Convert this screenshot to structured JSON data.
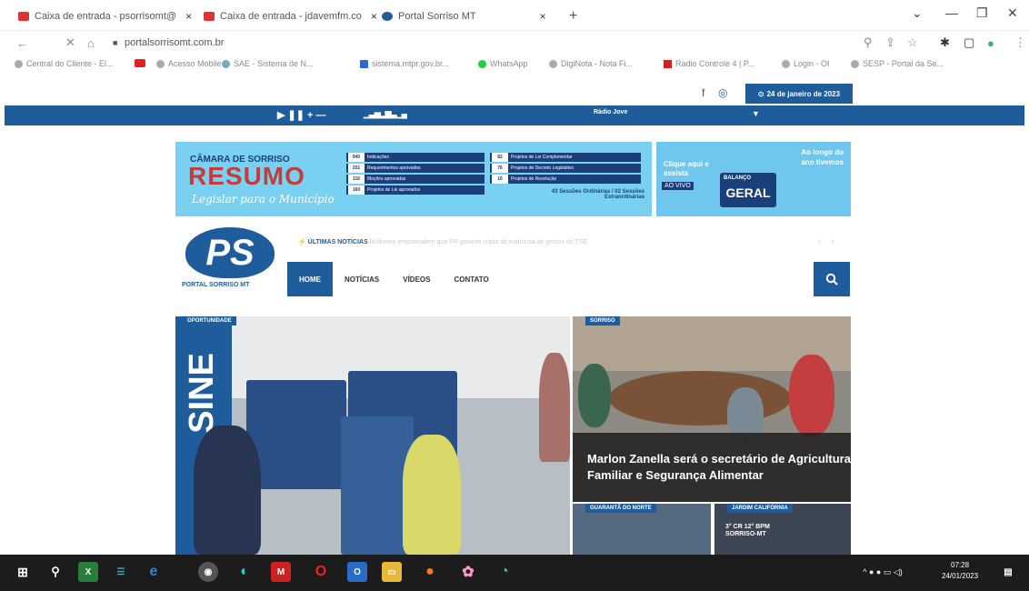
{
  "browser": {
    "tabs": [
      {
        "label": "Caixa de entrada - psorrisomt@",
        "close": "×"
      },
      {
        "label": "Caixa de entrada - jdavemfm.co",
        "close": "×"
      },
      {
        "label": "Portal Sorriso MT",
        "close": "×"
      }
    ],
    "new_tab": "+",
    "url": "portalsorrisomt.com.br",
    "bookmarks": [
      "Central do Cliente - El...",
      "Acesso Mobile",
      "SAE - Sistema de N...",
      "sistema.mtpr.gov.br...",
      "WhatsApp",
      "DigiNota - Nota Fi...",
      "Radio Controle 4 | P...",
      "Login - OI",
      "SESP - Portal da Se..."
    ]
  },
  "site": {
    "date": "24 de janeiro de 2023",
    "radio_player": {
      "controls": "▶ ❚❚ + —",
      "station": "Rádio Jove"
    },
    "banner_camara": {
      "line1": "CÂMARA DE SORRISO",
      "title": "RESUMO",
      "slogan": "Legislar para o Município",
      "stats_left": [
        {
          "n": "940",
          "label": "Indicações"
        },
        {
          "n": "201",
          "label": "Requerimentos aprovados"
        },
        {
          "n": "116",
          "label": "Moções aprovadas"
        },
        {
          "n": "160",
          "label": "Projetos de Lei aprovados"
        }
      ],
      "stats_right": [
        {
          "n": "82",
          "label": "Projetos de Lei Complementar"
        },
        {
          "n": "76",
          "label": "Projetos de Decreto Legislativo"
        },
        {
          "n": "16",
          "label": "Projetos de Resolução"
        }
      ],
      "sessions": "43 Sessões Ordinárias / 02 Sessões Extraordinárias"
    },
    "banner_live": {
      "cta": "Clique aqui e assista",
      "live": "AO VIVO",
      "badge_top": "BALANÇO",
      "badge": "GERAL",
      "right_text": "Ao longo do ano tivemos"
    },
    "logo": {
      "mark": "PS",
      "name": "PORTAL SORRISO MT"
    },
    "latest_news": {
      "label": "ÚLTIMAS NOTÍCIAS",
      "text": "Mulheres empreendem que PR garante cópia de matrícula de gestos do TSE"
    },
    "menu": [
      "HOME",
      "NOTÍCIAS",
      "VÍDEOS",
      "CONTATO"
    ],
    "hero_tag": "OPORTUNIDADE",
    "hero_sign": "SINE",
    "side_tag": "SORRISO",
    "side_headline": "Marlon Zanella será o secretário de Agricultura Familiar e Segurança Alimentar",
    "thumb_tags": [
      "GUARANTÃ DO NORTE",
      "JARDIM CALIFÓRNIA"
    ],
    "thumb_texts": [
      "3° CR 12° BPM SORRISO-MT"
    ]
  },
  "taskbar": {
    "time": "07:28",
    "date": "24/01/2023"
  },
  "colors": {
    "brand": "#1f5c9c",
    "accent": "#c43c3c"
  }
}
